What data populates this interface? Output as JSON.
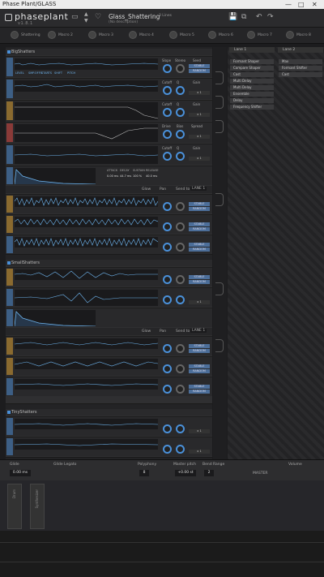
{
  "window": {
    "title": "Phase Plant/GLASS",
    "controls": [
      "—",
      "□",
      "✕"
    ]
  },
  "header": {
    "product": "phaseplant",
    "version": "v1.8.1",
    "preset_name": "Glass_Shattering",
    "preset_sub": "(No description)",
    "lines_label": "3 Lines",
    "icons": [
      "folder-icon",
      "arrows-icon",
      "heart-icon",
      "save-icon",
      "copy-icon",
      "undo-icon",
      "redo-icon"
    ]
  },
  "macros": [
    "Shattering",
    "Macro 2",
    "Macro 3",
    "Macro 4",
    "Macro 5",
    "Macro 6",
    "Macro 7",
    "Macro 8"
  ],
  "generators": [
    {
      "name": "BigShatters",
      "rows": [
        {
          "type": "sample",
          "strip": "blue",
          "level": "LEVEL",
          "pan": "PAN",
          "params": [
            "LEVEL",
            "SMP.OFFS",
            "STARTS",
            "SHIFT",
            "PITCH"
          ],
          "right": {
            "k1": "Slope",
            "k2": "Stereo",
            "seed": "Seed",
            "btn": "STABLE",
            "btn2": "RANDOM"
          }
        },
        {
          "type": "sample",
          "strip": "blue",
          "right": {
            "k1": "Cutoff",
            "k2": "Q",
            "seed": "Gain",
            "btn": "Slope",
            "btn2": "x 1"
          }
        },
        {
          "type": "filter",
          "strip": "orange",
          "right": {
            "k1": "Cutoff",
            "k2": "Q",
            "seed": "Gain",
            "btn": "Slope",
            "btn2": "x 1"
          }
        },
        {
          "type": "drive",
          "strip": "red",
          "right": {
            "k1": "Drive",
            "k2": "Bias",
            "seed": "Spread",
            "btn": "Shape",
            "btn2": "x 1"
          }
        },
        {
          "type": "filter",
          "strip": "blue",
          "right": {
            "k1": "Cutoff",
            "k2": "Q",
            "seed": "Gain",
            "btn": "Slope",
            "btn2": "x 1"
          }
        },
        {
          "type": "env",
          "strip": "blue",
          "params": [
            "ATTACK",
            "DECAY",
            "SUSTAIN",
            "RELEASE"
          ],
          "values": [
            "0.00 ms",
            "44.7 ms",
            "100 %",
            "40.0 ms"
          ]
        }
      ],
      "send_label": "Send to",
      "send_target": "LANE 1",
      "glow": "Glow",
      "pan": "Pan"
    },
    {
      "name": "SmallShatters",
      "rows": []
    },
    {
      "name": "TinyShatters",
      "rows": []
    }
  ],
  "modulators": {
    "tab1": "Lane 1",
    "tab2": "Lane 2",
    "items1": [
      "Formant Shaper",
      "Compare Shaper",
      "Cast",
      "Multi Delay",
      "Multi Delay",
      "Ensemble",
      "Delay",
      "Frequency Shifter"
    ],
    "items2": [
      "Max",
      "Formant Shifter",
      "Cast"
    ]
  },
  "footer": {
    "glide_label": "Glide",
    "glide_value": "0.00 ms",
    "legato": "Glide Legato",
    "poly_label": "Polyphony",
    "poly_value": "8",
    "master_pitch": "Master pitch",
    "pitch_value": "+0.00 st",
    "bend_label": "Bend Range",
    "bend_value": "2",
    "master": "MASTER",
    "volume_label": "Volume"
  },
  "panels": [
    "Drum",
    "Synthesizer"
  ],
  "accent": "#4a90d9"
}
